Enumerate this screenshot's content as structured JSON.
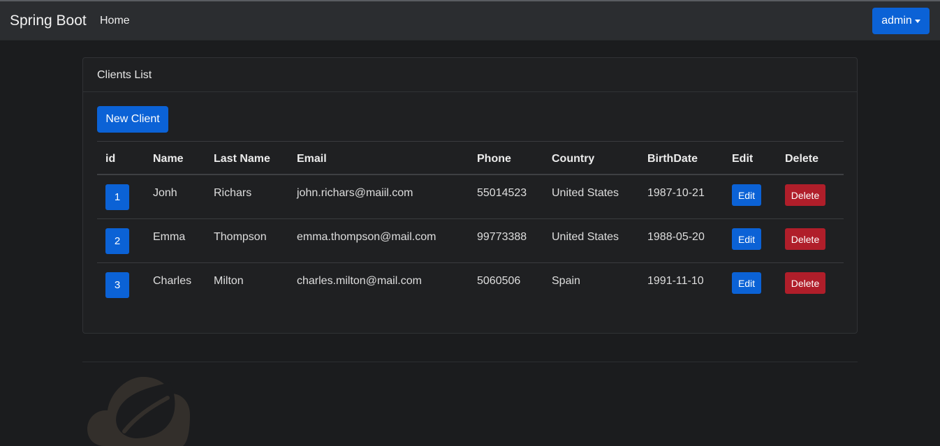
{
  "navbar": {
    "brand": "Spring Boot",
    "home": "Home",
    "user": "admin"
  },
  "card": {
    "title": "Clients List",
    "new_button": "New Client"
  },
  "table": {
    "headers": {
      "id": "id",
      "name": "Name",
      "last_name": "Last Name",
      "email": "Email",
      "phone": "Phone",
      "country": "Country",
      "birthdate": "BirthDate",
      "edit": "Edit",
      "delete": "Delete"
    },
    "rows": [
      {
        "id": "1",
        "name": "Jonh",
        "last_name": "Richars",
        "email": "john.richars@maiil.com",
        "phone": "55014523",
        "country": "United States",
        "birthdate": "1987-10-21",
        "edit": "Edit",
        "delete": "Delete"
      },
      {
        "id": "2",
        "name": "Emma",
        "last_name": "Thompson",
        "email": "emma.thompson@mail.com",
        "phone": "99773388",
        "country": "United States",
        "birthdate": "1988-05-20",
        "edit": "Edit",
        "delete": "Delete"
      },
      {
        "id": "3",
        "name": "Charles",
        "last_name": "Milton",
        "email": "charles.milton@mail.com",
        "phone": "5060506",
        "country": "Spain",
        "birthdate": "1991-11-10",
        "edit": "Edit",
        "delete": "Delete"
      }
    ]
  },
  "footer": {
    "logo_icon": "spring-leaf-cloud-logo"
  },
  "colors": {
    "primary": "#0b62d6",
    "danger": "#b01e2a",
    "background": "#1b1c1e",
    "navbar": "#2b2d30"
  }
}
